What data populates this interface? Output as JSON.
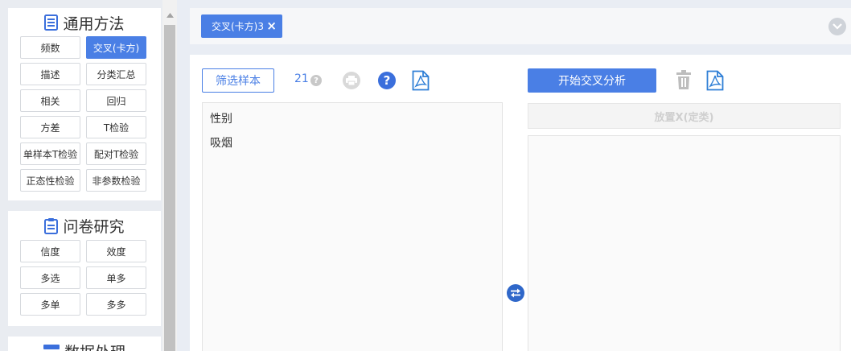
{
  "sidebar": {
    "general": {
      "title": "通用方法",
      "icon": "list-doc-icon",
      "buttons": [
        "频数",
        "交叉(卡方)",
        "描述",
        "分类汇总",
        "相关",
        "回归",
        "方差",
        "T检验",
        "单样本T检验",
        "配对T检验",
        "正态性检验",
        "非参数检验"
      ],
      "active": "交叉(卡方)"
    },
    "survey": {
      "title": "问卷研究",
      "icon": "clipboard-icon",
      "buttons": [
        "信度",
        "效度",
        "多选",
        "单多",
        "多单",
        "多多"
      ]
    },
    "data": {
      "title": "数据处理",
      "icon": "database-icon"
    }
  },
  "tabs": [
    {
      "label": "交叉(卡方)3",
      "close": "×"
    }
  ],
  "toolbar": {
    "filter_label": "筛选样本",
    "sample_count": "21",
    "info_mark": "?",
    "help_mark": "?"
  },
  "actions": {
    "start_label": "开始交叉分析"
  },
  "variables": [
    "性别",
    "吸烟"
  ],
  "drop_x_placeholder": "放置X(定类)",
  "colors": {
    "accent": "#4a7fe5",
    "help": "#3b6fdc",
    "swap": "#2f67c9",
    "pdf": "#2f7fd6"
  }
}
